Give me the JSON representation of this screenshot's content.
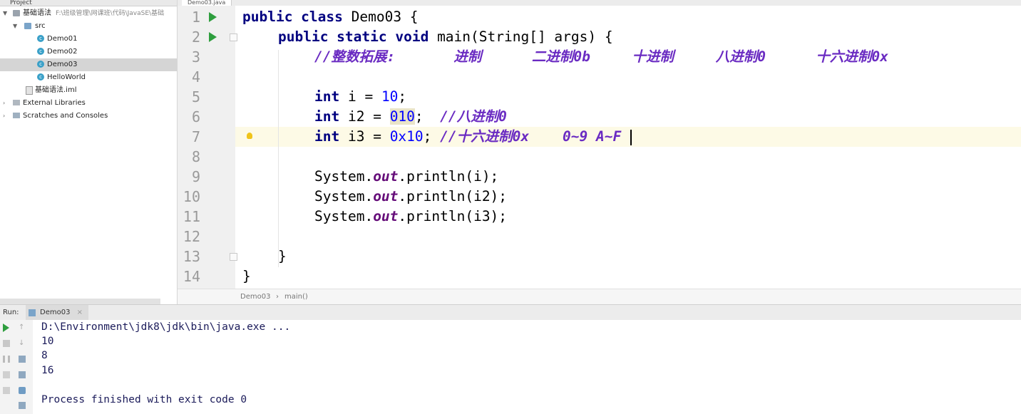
{
  "project_panel": {
    "header": "Project",
    "items": [
      {
        "label": "基础语法",
        "path": "F:\\班级管理\\网课班\\代码\\JavaSE\\基础",
        "type": "module"
      },
      {
        "label": "src",
        "type": "folder"
      },
      {
        "label": "Demo01",
        "type": "class"
      },
      {
        "label": "Demo02",
        "type": "class"
      },
      {
        "label": "Demo03",
        "type": "class",
        "selected": true
      },
      {
        "label": "HelloWorld",
        "type": "class"
      },
      {
        "label": "基础语法.iml",
        "type": "file"
      },
      {
        "label": "External Libraries",
        "type": "libraries"
      },
      {
        "label": "Scratches and Consoles",
        "type": "scratches"
      }
    ]
  },
  "editor": {
    "tab_label": "Demo03.java",
    "line_numbers": [
      "1",
      "2",
      "3",
      "4",
      "5",
      "6",
      "7",
      "8",
      "9",
      "10",
      "11",
      "12",
      "13",
      "14"
    ],
    "current_line": 7,
    "code": {
      "l1": {
        "kw": "public class",
        "rest": " Demo03 {"
      },
      "l2": {
        "kw": "public static void",
        "rest": " main(String[] args) {"
      },
      "l3": {
        "comment": "//整数拓展:       进制      二进制0b     十进制     八进制0      十六进制0x"
      },
      "l5": {
        "kw": "int",
        "mid": " i = ",
        "num": "10",
        "end": ";"
      },
      "l6": {
        "kw": "int",
        "mid": " i2 = ",
        "num": "010",
        "end": ";  ",
        "comment": "//八进制0"
      },
      "l7": {
        "kw": "int",
        "mid": " i3 = ",
        "num": "0x10",
        "end": "; ",
        "comment": "//十六进制0x    0~9 A~F"
      },
      "l9": {
        "pre": "System.",
        "field": "out",
        "post": ".println(i);"
      },
      "l10": {
        "pre": "System.",
        "field": "out",
        "post": ".println(i2);"
      },
      "l11": {
        "pre": "System.",
        "field": "out",
        "post": ".println(i3);"
      },
      "l13": {
        "text": "}"
      },
      "l14": {
        "text": "}"
      }
    }
  },
  "breadcrumb": {
    "class": "Demo03",
    "sep": "›",
    "method": "main()"
  },
  "run_panel": {
    "label": "Run:",
    "tab": "Demo03",
    "output": [
      "D:\\Environment\\jdk8\\jdk\\bin\\java.exe ...",
      "10",
      "8",
      "16",
      "",
      "Process finished with exit code 0"
    ]
  },
  "colors": {
    "keyword": "#000080",
    "number": "#0000ff",
    "comment": "#6a2bc2",
    "field": "#660e7a",
    "current_line": "#fdfae6",
    "run_green": "#2e9e3e"
  }
}
